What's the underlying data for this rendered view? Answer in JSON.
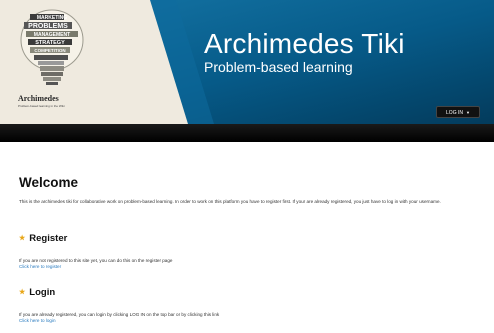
{
  "banner": {
    "title": "Archimedes Tiki",
    "subtitle": "Problem-based learning",
    "logo": {
      "words": [
        "MARKETING",
        "PROBLEMS",
        "MANAGEMENT",
        "STRATEGY",
        "COMPETITION"
      ],
      "name": "Archimedes",
      "tagline": "Problem-based learning in the Wiki"
    },
    "login_button": {
      "label": "LOG IN",
      "icon": "caret-down-icon"
    },
    "colors": {
      "banner_blue": "#04496f",
      "logo_bg": "#efeadf"
    }
  },
  "content": {
    "title": "Welcome",
    "intro": "This is the archimedes tiki for collaborative work on problem-based learning. In order to work on this platform you have to register first. If your are already registered, you just have to log in with your username.",
    "sections": [
      {
        "icon": "star-icon",
        "heading": "Register",
        "text": "If you are not registered to this site yet, you can do this on the register page",
        "link": "Click here to register"
      },
      {
        "icon": "star-icon",
        "heading": "Login",
        "text": "If you are already registered, you can login by clicking LOG IN on the top bar or by clicking this link",
        "link": "Click here to login"
      }
    ],
    "colors": {
      "link": "#2a7bbf",
      "star": "#e8a617"
    }
  }
}
